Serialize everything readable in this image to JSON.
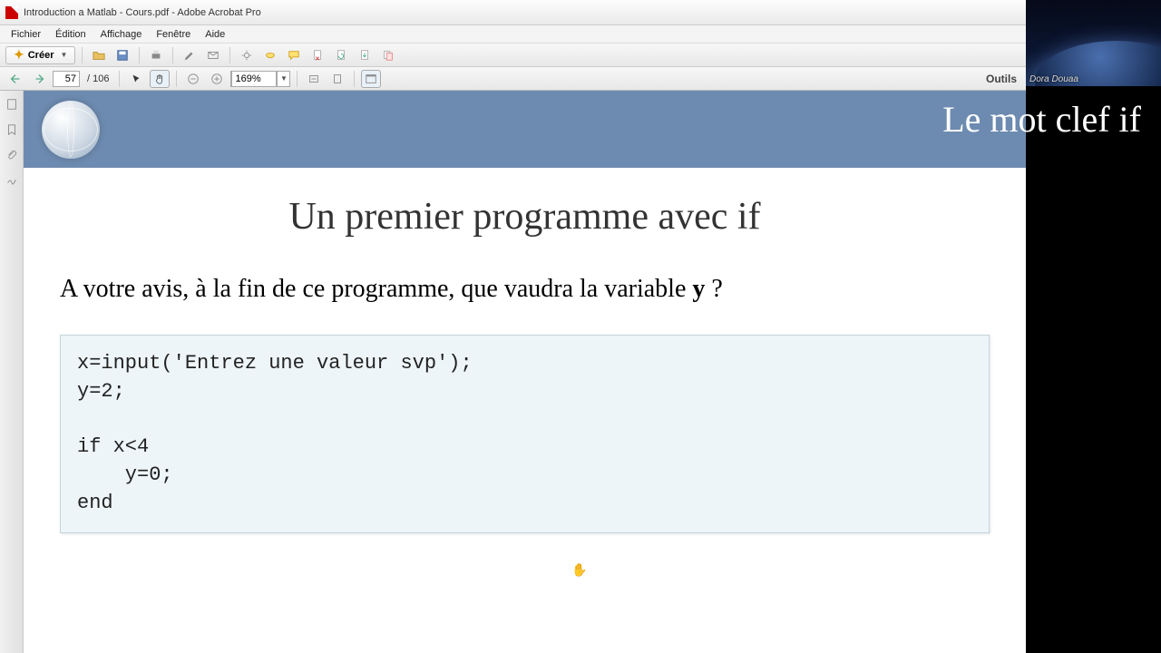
{
  "window": {
    "title": "Introduction a Matlab - Cours.pdf - Adobe Acrobat Pro"
  },
  "menu": {
    "file": "Fichier",
    "edit": "Édition",
    "view": "Affichage",
    "window": "Fenêtre",
    "help": "Aide"
  },
  "toolbar": {
    "create_label": "Créer",
    "tools_label": "Outils"
  },
  "nav": {
    "current_page": "57",
    "page_sep": "/",
    "total_pages": "106",
    "zoom": "169%"
  },
  "slide": {
    "header_title": "Le mot clef if",
    "heading": "Un premier programme avec if",
    "question": "A votre avis, à la fin de ce programme, que vaudra la variable ",
    "question_bold": "y",
    "question_tail": " ?",
    "code": "x=input('Entrez une valeur svp');\ny=2;\n\nif x<4\n    y=0;\nend"
  },
  "overlay": {
    "attendee": "Dora Douaa"
  }
}
